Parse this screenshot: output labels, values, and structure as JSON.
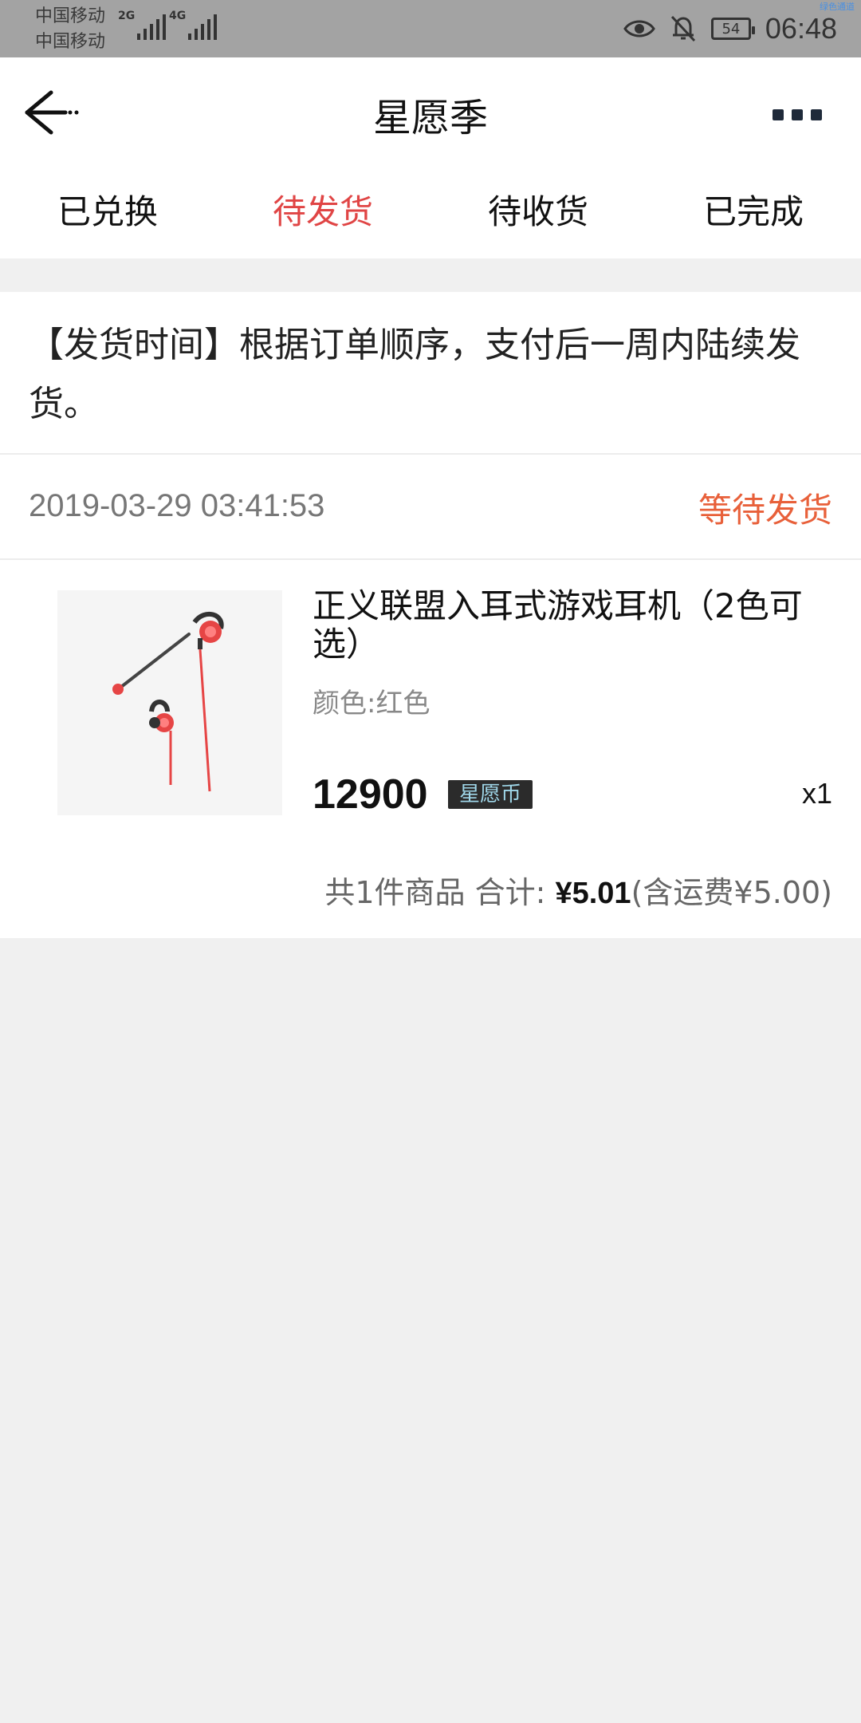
{
  "status_bar": {
    "carrier_1": "中国移动",
    "carrier_2": "中国移动",
    "signal_1_tag": "2G",
    "signal_2_tag": "4G",
    "battery": "54",
    "time": "06:48",
    "corner_tag": "绿色通道"
  },
  "navbar": {
    "title": "星愿季",
    "back_icon": "back-arrow-icon",
    "more_icon": "more-icon"
  },
  "tabs": [
    {
      "label": "已兑换",
      "active": false
    },
    {
      "label": "待发货",
      "active": true
    },
    {
      "label": "待收货",
      "active": false
    },
    {
      "label": "已完成",
      "active": false
    }
  ],
  "notice": "【发货时间】根据订单顺序，支付后一周内陆续发货。",
  "order": {
    "time": "2019-03-29 03:41:53",
    "status": "等待发货",
    "product": {
      "name": "正义联盟入耳式游戏耳机（2色可选）",
      "spec": "颜色:红色",
      "price": "12900",
      "currency_badge": "星愿币",
      "quantity": "x1"
    },
    "summary": {
      "prefix": "共1件商品 合计: ",
      "amount": "¥5.01",
      "shipping": "(含运费¥5.00)"
    }
  },
  "colors": {
    "accent": "#e04545",
    "status_orange": "#e8603a",
    "background": "#f0f0f0"
  }
}
